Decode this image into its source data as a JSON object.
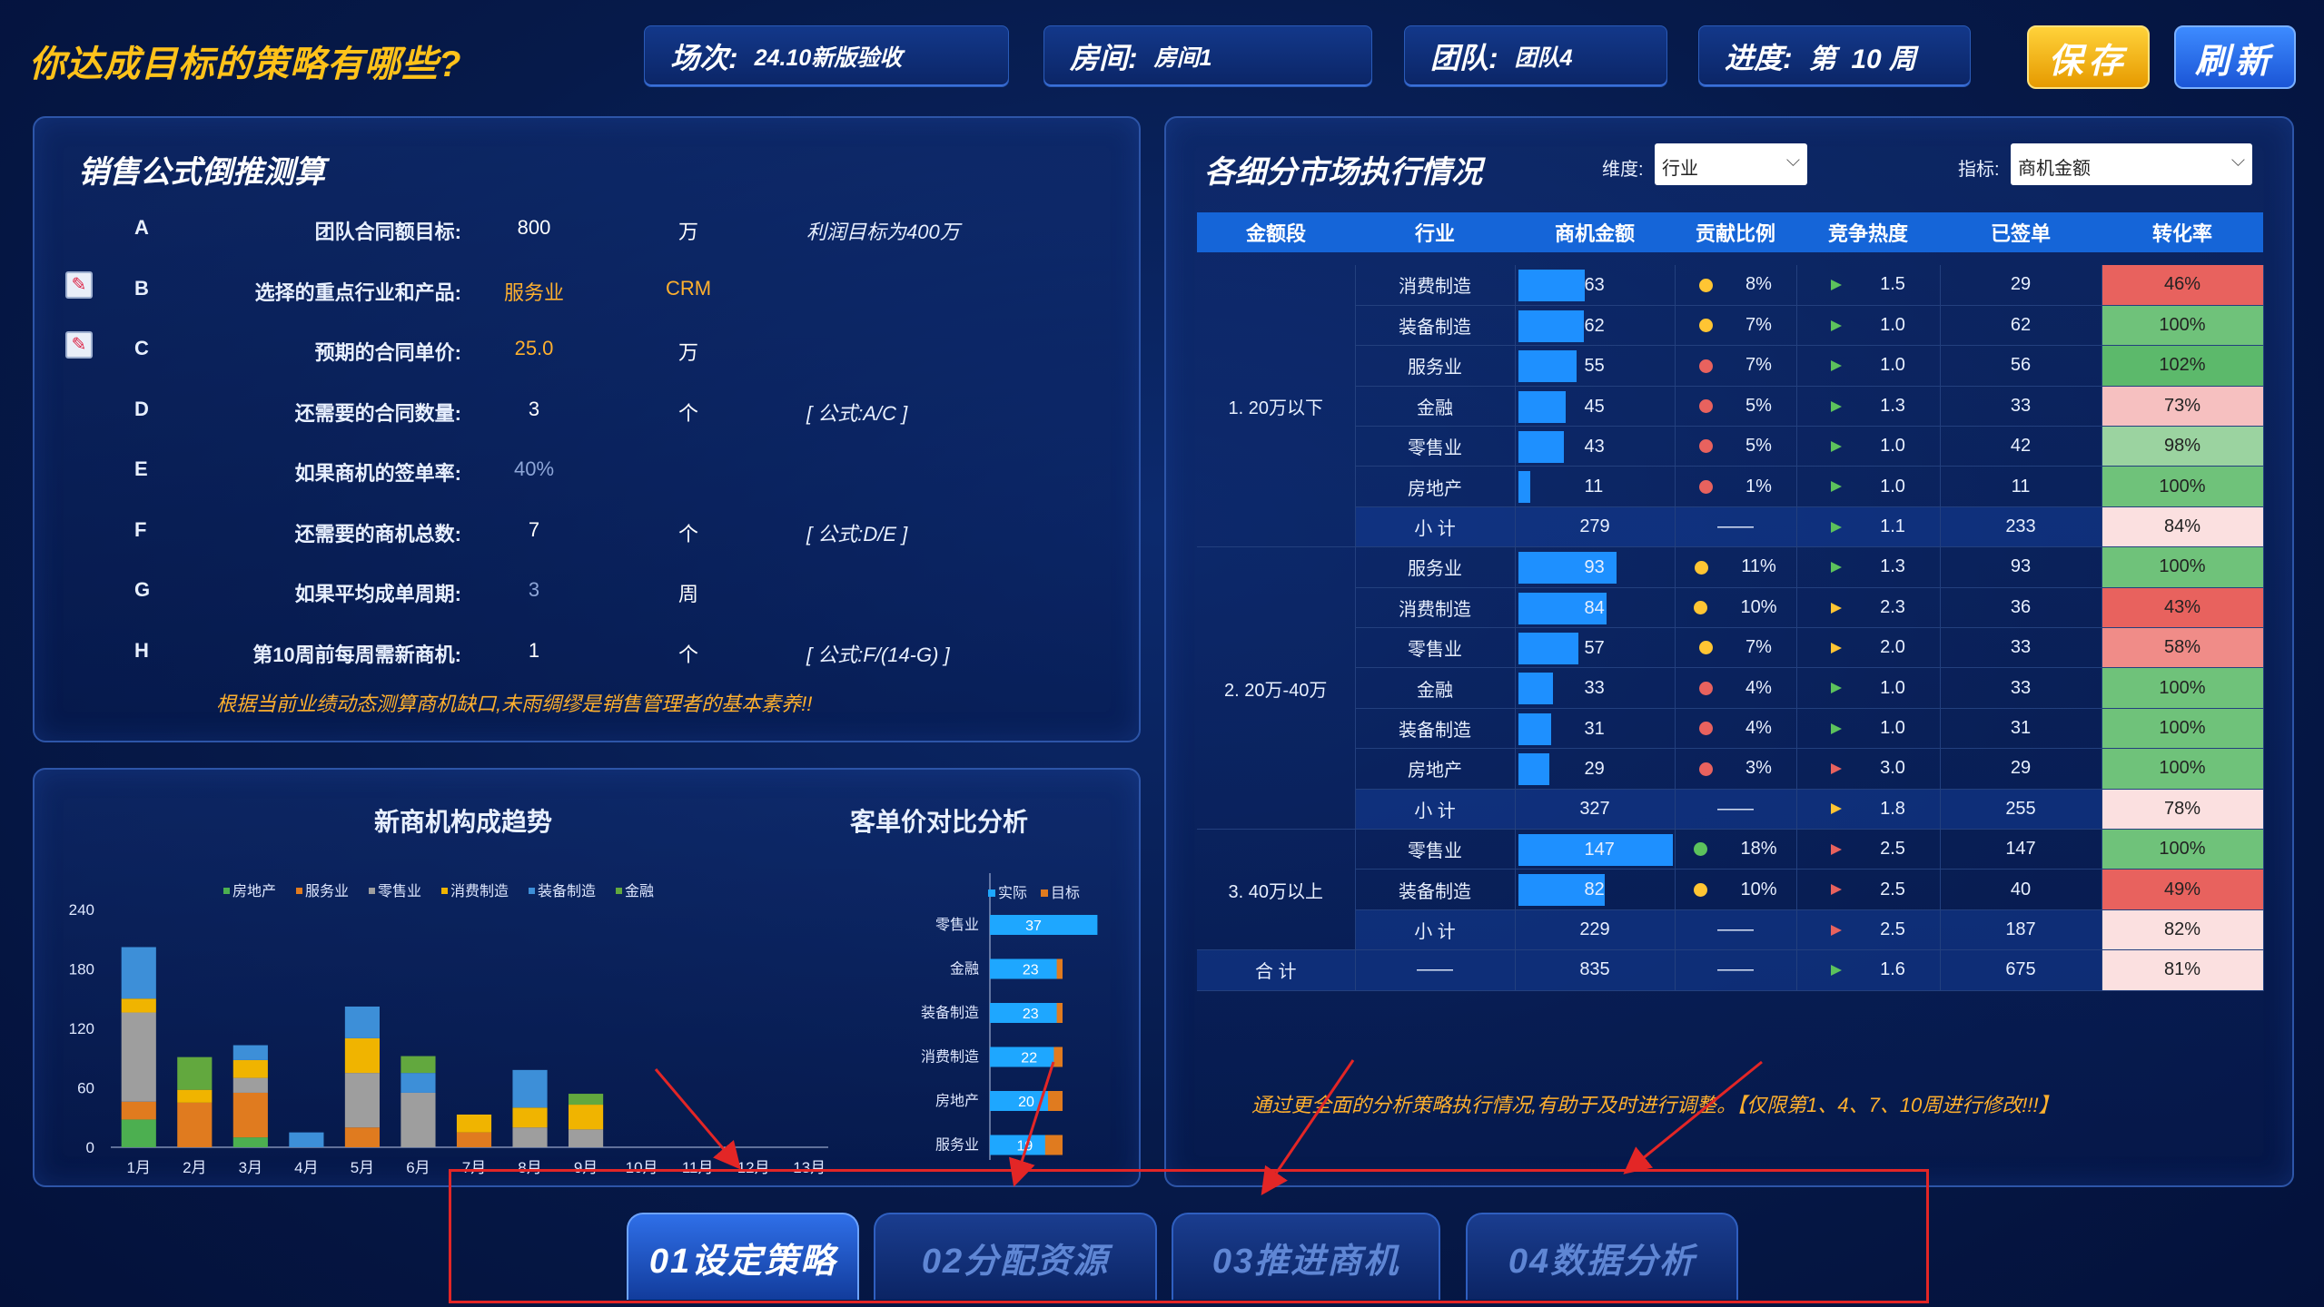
{
  "header": {
    "title": "你达成目标的策略有哪些?",
    "session_key": "场次:",
    "session_val": "24.10新版验收",
    "room_key": "房间:",
    "room_val": "房间1",
    "team_key": "团队:",
    "team_val": "团队4",
    "progress_key": "进度:",
    "progress_val": "第  10 周",
    "save": "保存",
    "refresh": "刷新"
  },
  "formula": {
    "title": "销售公式倒推测算",
    "rows": [
      {
        "code": "A",
        "label": "团队合同额目标:",
        "value": "800",
        "unit": "万",
        "note": "利润目标为400万",
        "vcolor": "#ffffff"
      },
      {
        "code": "B",
        "label": "选择的重点行业和产品:",
        "value": "服务业",
        "unit": "CRM",
        "note": "",
        "vcolor": "#ffb02e"
      },
      {
        "code": "C",
        "label": "预期的合同单价:",
        "value": "25.0",
        "unit": "万",
        "note": "",
        "vcolor": "#ffb02e"
      },
      {
        "code": "D",
        "label": "还需要的合同数量:",
        "value": "3",
        "unit": "个",
        "note": "[ 公式:A/C ]",
        "vcolor": "#ffffff"
      },
      {
        "code": "E",
        "label": "如果商机的签单率:",
        "value": "40%",
        "unit": "",
        "note": "",
        "vcolor": "#8ea6d8"
      },
      {
        "code": "F",
        "label": "还需要的商机总数:",
        "value": "7",
        "unit": "个",
        "note": "[ 公式:D/E ]",
        "vcolor": "#ffffff"
      },
      {
        "code": "G",
        "label": "如果平均成单周期:",
        "value": "3",
        "unit": "周",
        "note": "",
        "vcolor": "#8ea6d8"
      },
      {
        "code": "H",
        "label": "第10周前每周需新商机:",
        "value": "1",
        "unit": "个",
        "note": "[ 公式:F/(14-G) ]",
        "vcolor": "#ffffff"
      }
    ],
    "footer": "根据当前业绩动态测算商机缺口,未雨绸缪是销售管理者的基本素养!!"
  },
  "charts": {
    "trend_title": "新商机构成趋势",
    "price_title": "客单价对比分析"
  },
  "chart_data": [
    {
      "type": "bar",
      "stacked": true,
      "title": "新商机构成趋势",
      "categories": [
        "1月",
        "2月",
        "3月",
        "4月",
        "5月",
        "6月",
        "7月",
        "8月",
        "9月",
        "10月",
        "11月",
        "12月",
        "13月"
      ],
      "ylim": [
        0,
        240
      ],
      "yticks": [
        0,
        60,
        120,
        180,
        240
      ],
      "legend_position": "top",
      "series": [
        {
          "name": "房地产",
          "color": "#4caf50",
          "values": [
            28,
            0,
            10,
            0,
            0,
            0,
            0,
            0,
            0,
            0,
            0,
            0,
            0
          ]
        },
        {
          "name": "服务业",
          "color": "#e07b1f",
          "values": [
            18,
            45,
            45,
            0,
            20,
            0,
            15,
            0,
            0,
            0,
            0,
            0,
            0
          ]
        },
        {
          "name": "零售业",
          "color": "#9e9e9e",
          "values": [
            90,
            0,
            15,
            0,
            55,
            55,
            0,
            20,
            18,
            0,
            0,
            0,
            0
          ]
        },
        {
          "name": "消费制造",
          "color": "#f0b400",
          "values": [
            14,
            13,
            18,
            0,
            35,
            0,
            18,
            20,
            25,
            0,
            0,
            0,
            0
          ]
        },
        {
          "name": "装备制造",
          "color": "#3d8fd8",
          "values": [
            52,
            0,
            15,
            15,
            32,
            20,
            0,
            38,
            0,
            0,
            0,
            0,
            0
          ]
        },
        {
          "name": "金融",
          "color": "#62a83e",
          "values": [
            0,
            33,
            0,
            0,
            0,
            17,
            0,
            0,
            11,
            0,
            0,
            0,
            0
          ]
        }
      ]
    },
    {
      "type": "bar",
      "orientation": "horizontal",
      "title": "客单价对比分析",
      "categories": [
        "零售业",
        "金融",
        "装备制造",
        "消费制造",
        "房地产",
        "服务业"
      ],
      "legend_position": "top",
      "series": [
        {
          "name": "实际",
          "color": "#1ea7ff",
          "values": [
            37,
            23,
            23,
            22,
            20,
            19
          ]
        },
        {
          "name": "目标",
          "color": "#e07b1f",
          "values": [
            25,
            25,
            25,
            25,
            25,
            25
          ]
        }
      ]
    }
  ],
  "market": {
    "title": "各细分市场执行情况",
    "dim_label": "维度:",
    "dim_value": "行业",
    "metric_label": "指标:",
    "metric_value": "商机金额",
    "columns": [
      "金额段",
      "行业",
      "商机金额",
      "贡献比例",
      "竞争热度",
      "已签单",
      "转化率"
    ],
    "groups": [
      {
        "name": "1. 20万以下",
        "rows": [
          {
            "ind": "消费制造",
            "amt": 63,
            "pct": "8%",
            "dot": "#ffc533",
            "heat": "1.5",
            "flag": "#5cc25c",
            "signed": "29",
            "conv": "46%",
            "cbg": "#e8625e"
          },
          {
            "ind": "装备制造",
            "amt": 62,
            "pct": "7%",
            "dot": "#ffc533",
            "heat": "1.0",
            "flag": "#5cc25c",
            "signed": "62",
            "conv": "100%",
            "cbg": "#6fc27a"
          },
          {
            "ind": "服务业",
            "amt": 55,
            "pct": "7%",
            "dot": "#e8625e",
            "heat": "1.0",
            "flag": "#5cc25c",
            "signed": "56",
            "conv": "102%",
            "cbg": "#5cb96b"
          },
          {
            "ind": "金融",
            "amt": 45,
            "pct": "5%",
            "dot": "#e8625e",
            "heat": "1.3",
            "flag": "#5cc25c",
            "signed": "33",
            "conv": "73%",
            "cbg": "#f6c0c0"
          },
          {
            "ind": "零售业",
            "amt": 43,
            "pct": "5%",
            "dot": "#e8625e",
            "heat": "1.0",
            "flag": "#5cc25c",
            "signed": "42",
            "conv": "98%",
            "cbg": "#9bd3a0"
          },
          {
            "ind": "房地产",
            "amt": 11,
            "pct": "1%",
            "dot": "#e8625e",
            "heat": "1.0",
            "flag": "#5cc25c",
            "signed": "11",
            "conv": "100%",
            "cbg": "#6fc27a"
          }
        ],
        "sub": {
          "label": "小 计",
          "amt": "279",
          "pct": "——",
          "heat": "1.1",
          "flag": "#5cc25c",
          "signed": "233",
          "conv": "84%",
          "cbg": "#fbe0e0"
        }
      },
      {
        "name": "2. 20万-40万",
        "rows": [
          {
            "ind": "服务业",
            "amt": 93,
            "pct": "11%",
            "dot": "#ffc533",
            "heat": "1.3",
            "flag": "#5cc25c",
            "signed": "93",
            "conv": "100%",
            "cbg": "#6fc27a"
          },
          {
            "ind": "消费制造",
            "amt": 84,
            "pct": "10%",
            "dot": "#ffc533",
            "heat": "2.3",
            "flag": "#ffc533",
            "signed": "36",
            "conv": "43%",
            "cbg": "#e8625e"
          },
          {
            "ind": "零售业",
            "amt": 57,
            "pct": "7%",
            "dot": "#ffc533",
            "heat": "2.0",
            "flag": "#ffc533",
            "signed": "33",
            "conv": "58%",
            "cbg": "#f08c88"
          },
          {
            "ind": "金融",
            "amt": 33,
            "pct": "4%",
            "dot": "#e8625e",
            "heat": "1.0",
            "flag": "#5cc25c",
            "signed": "33",
            "conv": "100%",
            "cbg": "#6fc27a"
          },
          {
            "ind": "装备制造",
            "amt": 31,
            "pct": "4%",
            "dot": "#e8625e",
            "heat": "1.0",
            "flag": "#5cc25c",
            "signed": "31",
            "conv": "100%",
            "cbg": "#6fc27a"
          },
          {
            "ind": "房地产",
            "amt": 29,
            "pct": "3%",
            "dot": "#e8625e",
            "heat": "3.0",
            "flag": "#e8625e",
            "signed": "29",
            "conv": "100%",
            "cbg": "#6fc27a"
          }
        ],
        "sub": {
          "label": "小 计",
          "amt": "327",
          "pct": "——",
          "heat": "1.8",
          "flag": "#ffc533",
          "signed": "255",
          "conv": "78%",
          "cbg": "#fbe0e0"
        }
      },
      {
        "name": "3. 40万以上",
        "rows": [
          {
            "ind": "零售业",
            "amt": 147,
            "pct": "18%",
            "dot": "#5cc25c",
            "heat": "2.5",
            "flag": "#e8625e",
            "signed": "147",
            "conv": "100%",
            "cbg": "#6fc27a"
          },
          {
            "ind": "装备制造",
            "amt": 82,
            "pct": "10%",
            "dot": "#ffc533",
            "heat": "2.5",
            "flag": "#e8625e",
            "signed": "40",
            "conv": "49%",
            "cbg": "#e8625e"
          }
        ],
        "sub": {
          "label": "小 计",
          "amt": "229",
          "pct": "——",
          "heat": "2.5",
          "flag": "#e8625e",
          "signed": "187",
          "conv": "82%",
          "cbg": "#fbe0e0"
        }
      }
    ],
    "total": {
      "label": "合 计",
      "ind": "——",
      "amt": "835",
      "pct": "——",
      "heat": "1.6",
      "flag": "#5cc25c",
      "signed": "675",
      "conv": "81%",
      "cbg": "#fbe0e0"
    },
    "footer": "通过更全面的分析策略执行情况,有助于及时进行调整。【仅限第1、4、7、10周进行修改!!!】"
  },
  "tabs": [
    {
      "label": "01设定策略",
      "active": true
    },
    {
      "label": "02分配资源",
      "active": false
    },
    {
      "label": "03推进商机",
      "active": false
    },
    {
      "label": "04数据分析",
      "active": false
    }
  ]
}
